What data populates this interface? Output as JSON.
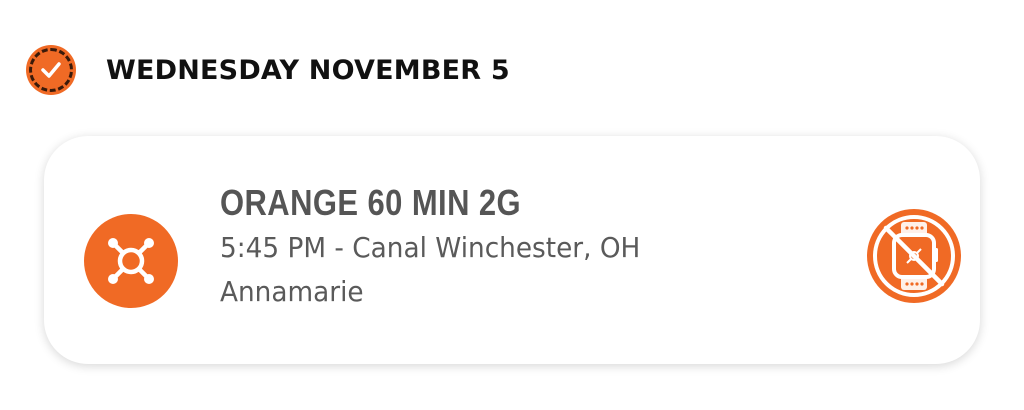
{
  "day": {
    "title": "WEDNESDAY NOVEMBER 5",
    "status_icon": "checked-dashed-circle-icon"
  },
  "class": {
    "name": "ORANGE 60 MIN 2G",
    "time_location": "5:45 PM - Canal Winchester, OH",
    "coach": "Annamarie",
    "logo_icon": "orangetheory-splat-logo",
    "status_icon": "no-heart-rate-monitor-icon"
  },
  "colors": {
    "accent": "#f06a25",
    "title_text": "#111111",
    "card_text": "#5a5a5a",
    "card_background": "#ffffff"
  }
}
